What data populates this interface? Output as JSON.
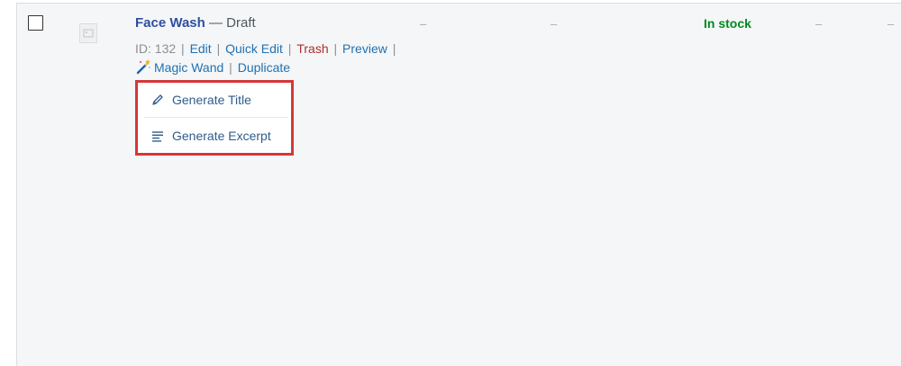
{
  "product": {
    "name": "Face Wash",
    "separator": " — ",
    "status": "Draft",
    "id_label": "ID: 132",
    "actions": {
      "edit": "Edit",
      "quick_edit": "Quick Edit",
      "trash": "Trash",
      "preview": "Preview",
      "magic_wand": "Magic Wand",
      "duplicate": "Duplicate"
    },
    "columns": {
      "col1": "–",
      "col2": "–",
      "stock": "In stock",
      "col4": "–",
      "col5": "–"
    }
  },
  "dropdown": {
    "generate_title": "Generate Title",
    "generate_excerpt": "Generate Excerpt"
  },
  "colors": {
    "link": "#2271b1",
    "trash": "#b32d2e",
    "in_stock": "#008a20",
    "highlight_border": "#d63638"
  },
  "icons": {
    "wand": "magic-wand-icon",
    "title": "pencil-icon",
    "excerpt": "text-lines-icon",
    "thumbnail": "image-placeholder-icon"
  }
}
